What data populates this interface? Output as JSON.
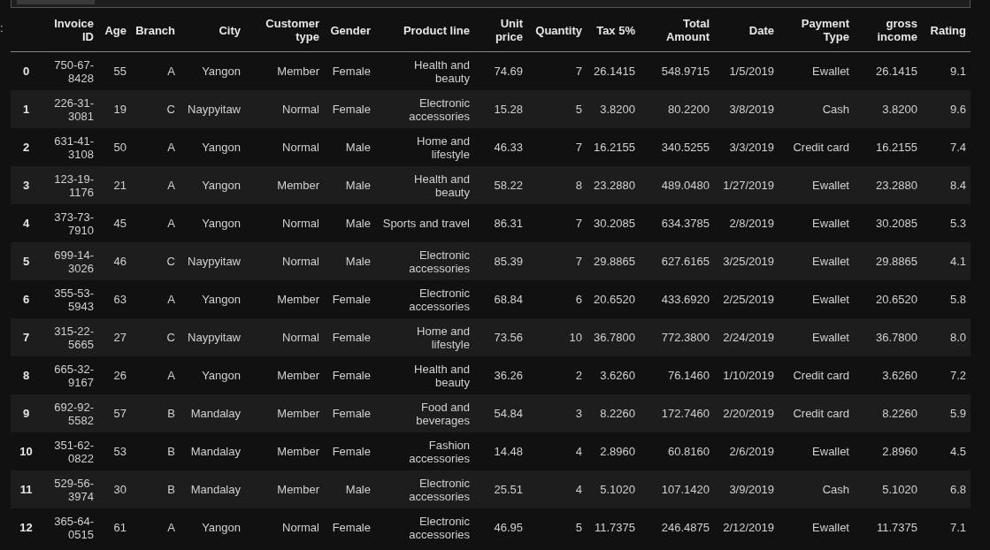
{
  "prompt": ":",
  "table": {
    "columns": [
      "Invoice ID",
      "Age",
      "Branch",
      "City",
      "Customer type",
      "Gender",
      "Product line",
      "Unit price",
      "Quantity",
      "Tax 5%",
      "Total Amount",
      "Date",
      "Payment Type",
      "gross income",
      "Rating"
    ],
    "rows": [
      {
        "index": "0",
        "cells": [
          "750-67-8428",
          "55",
          "A",
          "Yangon",
          "Member",
          "Female",
          "Health and beauty",
          "74.69",
          "7",
          "26.1415",
          "548.9715",
          "1/5/2019",
          "Ewallet",
          "26.1415",
          "9.1"
        ]
      },
      {
        "index": "1",
        "cells": [
          "226-31-3081",
          "19",
          "C",
          "Naypyitaw",
          "Normal",
          "Female",
          "Electronic accessories",
          "15.28",
          "5",
          "3.8200",
          "80.2200",
          "3/8/2019",
          "Cash",
          "3.8200",
          "9.6"
        ]
      },
      {
        "index": "2",
        "cells": [
          "631-41-3108",
          "50",
          "A",
          "Yangon",
          "Normal",
          "Male",
          "Home and lifestyle",
          "46.33",
          "7",
          "16.2155",
          "340.5255",
          "3/3/2019",
          "Credit card",
          "16.2155",
          "7.4"
        ]
      },
      {
        "index": "3",
        "cells": [
          "123-19-1176",
          "21",
          "A",
          "Yangon",
          "Member",
          "Male",
          "Health and beauty",
          "58.22",
          "8",
          "23.2880",
          "489.0480",
          "1/27/2019",
          "Ewallet",
          "23.2880",
          "8.4"
        ]
      },
      {
        "index": "4",
        "cells": [
          "373-73-7910",
          "45",
          "A",
          "Yangon",
          "Normal",
          "Male",
          "Sports and travel",
          "86.31",
          "7",
          "30.2085",
          "634.3785",
          "2/8/2019",
          "Ewallet",
          "30.2085",
          "5.3"
        ]
      },
      {
        "index": "5",
        "cells": [
          "699-14-3026",
          "46",
          "C",
          "Naypyitaw",
          "Normal",
          "Male",
          "Electronic accessories",
          "85.39",
          "7",
          "29.8865",
          "627.6165",
          "3/25/2019",
          "Ewallet",
          "29.8865",
          "4.1"
        ]
      },
      {
        "index": "6",
        "cells": [
          "355-53-5943",
          "63",
          "A",
          "Yangon",
          "Member",
          "Female",
          "Electronic accessories",
          "68.84",
          "6",
          "20.6520",
          "433.6920",
          "2/25/2019",
          "Ewallet",
          "20.6520",
          "5.8"
        ]
      },
      {
        "index": "7",
        "cells": [
          "315-22-5665",
          "27",
          "C",
          "Naypyitaw",
          "Normal",
          "Female",
          "Home and lifestyle",
          "73.56",
          "10",
          "36.7800",
          "772.3800",
          "2/24/2019",
          "Ewallet",
          "36.7800",
          "8.0"
        ]
      },
      {
        "index": "8",
        "cells": [
          "665-32-9167",
          "26",
          "A",
          "Yangon",
          "Member",
          "Female",
          "Health and beauty",
          "36.26",
          "2",
          "3.6260",
          "76.1460",
          "1/10/2019",
          "Credit card",
          "3.6260",
          "7.2"
        ]
      },
      {
        "index": "9",
        "cells": [
          "692-92-5582",
          "57",
          "B",
          "Mandalay",
          "Member",
          "Female",
          "Food and beverages",
          "54.84",
          "3",
          "8.2260",
          "172.7460",
          "2/20/2019",
          "Credit card",
          "8.2260",
          "5.9"
        ]
      },
      {
        "index": "10",
        "cells": [
          "351-62-0822",
          "53",
          "B",
          "Mandalay",
          "Member",
          "Female",
          "Fashion accessories",
          "14.48",
          "4",
          "2.8960",
          "60.8160",
          "2/6/2019",
          "Ewallet",
          "2.8960",
          "4.5"
        ]
      },
      {
        "index": "11",
        "cells": [
          "529-56-3974",
          "30",
          "B",
          "Mandalay",
          "Member",
          "Male",
          "Electronic accessories",
          "25.51",
          "4",
          "5.1020",
          "107.1420",
          "3/9/2019",
          "Cash",
          "5.1020",
          "6.8"
        ]
      },
      {
        "index": "12",
        "cells": [
          "365-64-0515",
          "61",
          "A",
          "Yangon",
          "Normal",
          "Female",
          "Electronic accessories",
          "46.95",
          "5",
          "11.7375",
          "246.4875",
          "2/12/2019",
          "Ewallet",
          "11.7375",
          "7.1"
        ]
      }
    ]
  }
}
